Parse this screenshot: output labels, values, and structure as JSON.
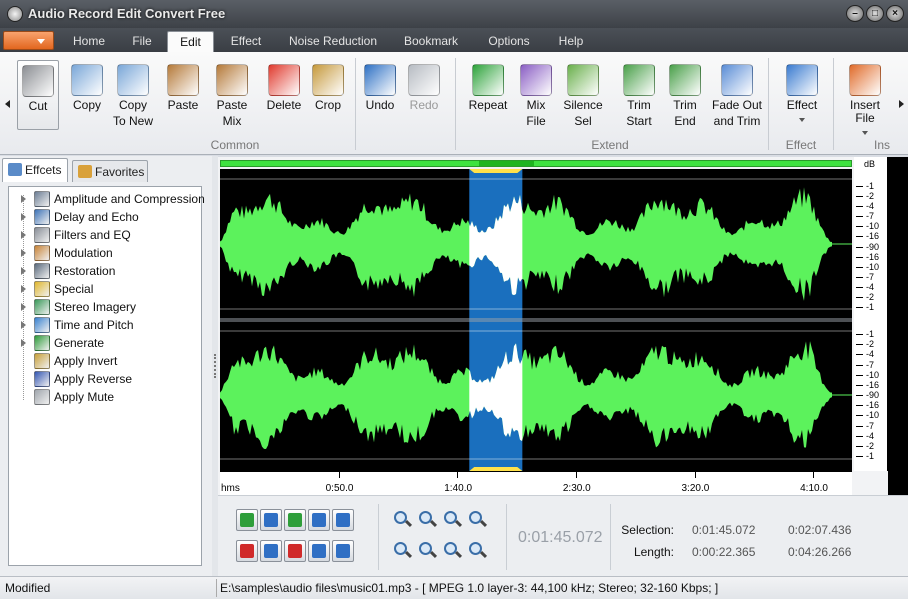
{
  "window": {
    "title": "Audio Record Edit Convert Free",
    "min_symbol": "–",
    "max_symbol": "□",
    "close_symbol": "×"
  },
  "menu_tabs": [
    {
      "label": "Home",
      "active": false
    },
    {
      "label": "File",
      "active": false
    },
    {
      "label": "Edit",
      "active": true
    },
    {
      "label": "Effect",
      "active": false
    },
    {
      "label": "Noise Reduction",
      "active": false
    },
    {
      "label": "Bookmark",
      "active": false
    },
    {
      "label": "Options",
      "active": false
    },
    {
      "label": "Help",
      "active": false
    }
  ],
  "ribbon": {
    "groups": [
      "Common",
      "Extend",
      "Effect",
      "Ins"
    ],
    "buttons": [
      {
        "name": "cut",
        "line1": "Cut",
        "line2": "",
        "icon": "scissors-icon",
        "selected": true,
        "disabled": false
      },
      {
        "name": "copy",
        "line1": "Copy",
        "line2": "",
        "icon": "copy-icon",
        "selected": false,
        "disabled": false
      },
      {
        "name": "copy-to-new",
        "line1": "Copy",
        "line2": "To New",
        "icon": "copy-new-icon",
        "selected": false,
        "disabled": false
      },
      {
        "name": "paste",
        "line1": "Paste",
        "line2": "",
        "icon": "clipboard-icon",
        "selected": false,
        "disabled": false
      },
      {
        "name": "paste-mix",
        "line1": "Paste",
        "line2": "Mix",
        "icon": "paste-mix-icon",
        "selected": false,
        "disabled": false
      },
      {
        "name": "delete",
        "line1": "Delete",
        "line2": "",
        "icon": "red-x-icon",
        "selected": false,
        "disabled": false
      },
      {
        "name": "crop",
        "line1": "Crop",
        "line2": "",
        "icon": "crop-icon",
        "selected": false,
        "disabled": false
      },
      {
        "name": "undo",
        "line1": "Undo",
        "line2": "",
        "icon": "undo-arrow-icon",
        "selected": false,
        "disabled": false
      },
      {
        "name": "redo",
        "line1": "Redo",
        "line2": "",
        "icon": "redo-arrow-icon",
        "selected": false,
        "disabled": true
      },
      {
        "name": "repeat",
        "line1": "Repeat",
        "line2": "",
        "icon": "repeat-icon",
        "selected": false,
        "disabled": false
      },
      {
        "name": "mix-file",
        "line1": "Mix",
        "line2": "File",
        "icon": "mix-file-icon",
        "selected": false,
        "disabled": false
      },
      {
        "name": "silence-sel",
        "line1": "Silence",
        "line2": "Sel",
        "icon": "silence-icon",
        "selected": false,
        "disabled": false
      },
      {
        "name": "trim-start",
        "line1": "Trim",
        "line2": "Start",
        "icon": "trim-start-icon",
        "selected": false,
        "disabled": false
      },
      {
        "name": "trim-end",
        "line1": "Trim",
        "line2": "End",
        "icon": "trim-end-icon",
        "selected": false,
        "disabled": false
      },
      {
        "name": "fade-out-trim",
        "line1": "Fade Out",
        "line2": "and Trim",
        "icon": "fade-out-icon",
        "selected": false,
        "disabled": false
      },
      {
        "name": "effect",
        "line1": "Effect",
        "line2": "",
        "icon": "effect-icon",
        "selected": false,
        "disabled": false
      },
      {
        "name": "insert-file",
        "line1": "Insert File",
        "line2": "",
        "icon": "insert-file-icon",
        "selected": false,
        "disabled": false
      }
    ]
  },
  "left_panel": {
    "tabs": [
      {
        "label": "Effcets",
        "icon": "effects-icon"
      },
      {
        "label": "Favorites",
        "icon": "favorites-icon"
      }
    ],
    "items": [
      {
        "label": "Amplitude and Compression",
        "expandable": true,
        "color": "#6d7f96"
      },
      {
        "label": "Delay and Echo",
        "expandable": true,
        "color": "#3f74b8"
      },
      {
        "label": "Filters and EQ",
        "expandable": true,
        "color": "#8a8f98"
      },
      {
        "label": "Modulation",
        "expandable": true,
        "color": "#c88438"
      },
      {
        "label": "Restoration",
        "expandable": true,
        "color": "#5b6b7e"
      },
      {
        "label": "Special",
        "expandable": true,
        "color": "#e0b72e"
      },
      {
        "label": "Stereo Imagery",
        "expandable": true,
        "color": "#3b9a5a"
      },
      {
        "label": "Time and Pitch",
        "expandable": true,
        "color": "#3a83d0"
      },
      {
        "label": "Generate",
        "expandable": true,
        "color": "#2f9c3b"
      },
      {
        "label": "Apply Invert",
        "expandable": false,
        "color": "#c8a03a"
      },
      {
        "label": "Apply Reverse",
        "expandable": false,
        "color": "#3558b4"
      },
      {
        "label": "Apply Mute",
        "expandable": false,
        "color": "#a0a6ad"
      }
    ]
  },
  "waveform": {
    "colors": {
      "wave": "#5cf25c",
      "selection": "#1a6fbe",
      "background": "#000000",
      "selection_wave": "#ffffff"
    },
    "selection_start_s": 105.072,
    "selection_end_s": 127.436,
    "audio_end_s": 256.266,
    "db_unit": "dB",
    "db_ticks_top": [
      "-1",
      "-2",
      "-4",
      "-7",
      "-10",
      "-16",
      "-90",
      "-16",
      "-10",
      "-7",
      "-4",
      "-2",
      "-1"
    ],
    "db_ticks_bottom": [
      "-1",
      "-2",
      "-4",
      "-7",
      "-10",
      "-16",
      "-90",
      "-16",
      "-10",
      "-7",
      "-4",
      "-2",
      "-1"
    ],
    "time_unit": "hms",
    "time_labels": [
      {
        "label": "0:50.0",
        "t": 50
      },
      {
        "label": "1:40.0",
        "t": 100
      },
      {
        "label": "2:30.0",
        "t": 150
      },
      {
        "label": "3:20.0",
        "t": 200
      },
      {
        "label": "4:10.0",
        "t": 250
      }
    ]
  },
  "transport": {
    "row1": [
      {
        "name": "play-button",
        "icon": "play-icon"
      },
      {
        "name": "loop-button",
        "icon": "loop-icon"
      },
      {
        "name": "play-selection-button",
        "icon": "play-circle-icon"
      },
      {
        "name": "rewind-button",
        "icon": "rewind-icon"
      },
      {
        "name": "fast-forward-button",
        "icon": "fast-forward-icon"
      }
    ],
    "row2": [
      {
        "name": "stop-button",
        "icon": "stop-icon"
      },
      {
        "name": "pause-button",
        "icon": "pause-icon"
      },
      {
        "name": "record-button",
        "icon": "record-icon"
      },
      {
        "name": "go-start-button",
        "icon": "skip-start-icon"
      },
      {
        "name": "go-end-button",
        "icon": "skip-end-icon"
      }
    ],
    "zoom": [
      {
        "name": "zoom-in-horizontal",
        "icon": "zoom-in-icon"
      },
      {
        "name": "zoom-out-horizontal",
        "icon": "zoom-out-icon"
      },
      {
        "name": "zoom-selection",
        "icon": "zoom-selection-icon"
      },
      {
        "name": "zoom-full",
        "icon": "zoom-full-icon"
      },
      {
        "name": "zoom-in-vertical",
        "icon": "zoom-in-vertical-icon"
      },
      {
        "name": "zoom-out-vertical",
        "icon": "zoom-out-vertical-icon"
      },
      {
        "name": "zoom-fit-vertical",
        "icon": "zoom-fit-icon"
      },
      {
        "name": "zoom-reset",
        "icon": "zoom-reset-icon"
      }
    ],
    "current_time": "0:01:45.072",
    "selection_label": "Selection:",
    "selection_start": "0:01:45.072",
    "selection_end": "0:02:07.436",
    "length_label": "Length:",
    "length_sel": "0:00:22.365",
    "length_total": "0:04:26.266"
  },
  "status": {
    "state": "Modified",
    "file_info": "E:\\samples\\audio files\\music01.mp3 - [ MPEG 1.0 layer-3: 44,100 kHz; Stereo; 32-160 Kbps;  ]"
  }
}
